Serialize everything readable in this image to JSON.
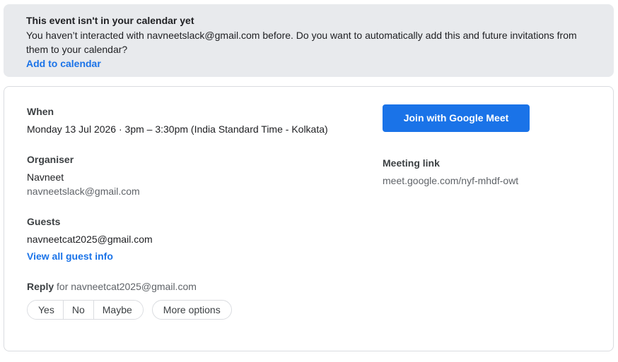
{
  "banner": {
    "title": "This event isn't in your calendar yet",
    "message": "You haven’t interacted with navneetslack@gmail.com before. Do you want to automatically add this and future invitations from them to your calendar?",
    "add_link": "Add to calendar"
  },
  "event": {
    "when_label": "When",
    "when_value": "Monday 13 Jul 2026 · 3pm – 3:30pm (India Standard Time - Kolkata)",
    "organiser_label": "Organiser",
    "organiser_name": "Navneet",
    "organiser_email": "navneetslack@gmail.com",
    "guests_label": "Guests",
    "guest_email": "navneetcat2025@gmail.com",
    "view_guests_link": "View all guest info",
    "reply_label": "Reply",
    "reply_for": "for navneetcat2025@gmail.com",
    "reply_options": [
      "Yes",
      "No",
      "Maybe"
    ],
    "more_options": "More options"
  },
  "meet": {
    "join_button": "Join with Google Meet",
    "link_label": "Meeting link",
    "link_value": "meet.google.com/nyf-mhdf-owt"
  },
  "colors": {
    "accent": "#1a73e8",
    "banner_bg": "#e8eaed",
    "border": "#dadce0"
  }
}
